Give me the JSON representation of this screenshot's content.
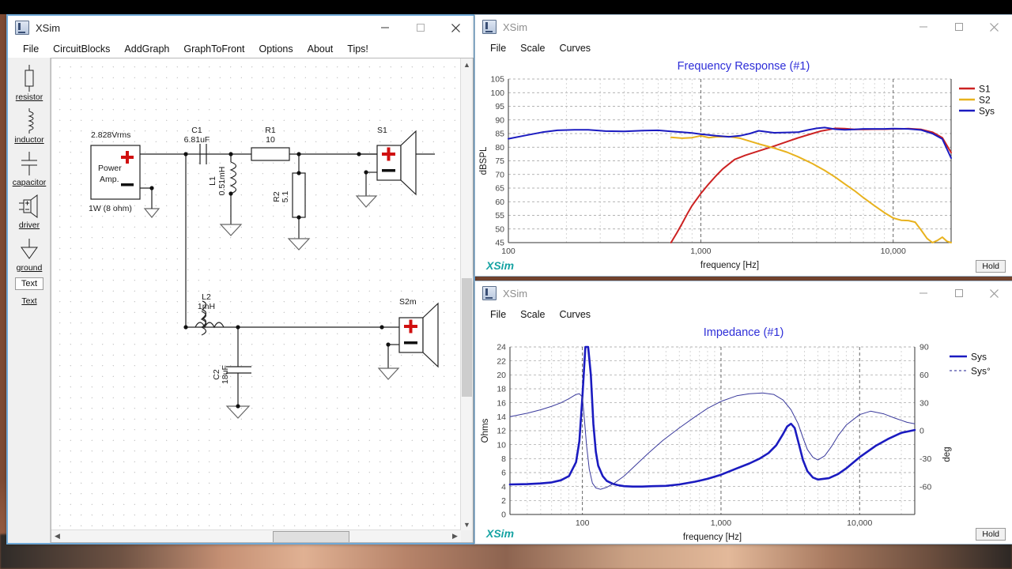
{
  "circuit_window": {
    "title": "XSim",
    "menus": [
      "File",
      "CircuitBlocks",
      "AddGraph",
      "GraphToFront",
      "Options",
      "About",
      "Tips!"
    ],
    "window_buttons": {
      "minimize": "minimize-icon",
      "maximize": "maximize-icon",
      "close": "close-icon"
    },
    "palette": [
      {
        "name": "resistor",
        "label": "resistor",
        "icon": "resistor-icon"
      },
      {
        "name": "inductor",
        "label": "inductor",
        "icon": "inductor-icon"
      },
      {
        "name": "capacitor",
        "label": "capacitor",
        "icon": "capacitor-icon"
      },
      {
        "name": "driver",
        "label": "driver",
        "icon": "driver-icon"
      },
      {
        "name": "ground",
        "label": "ground",
        "icon": "ground-icon"
      },
      {
        "name": "text-box",
        "label": "Text",
        "icon": "text-box-icon"
      },
      {
        "name": "text",
        "label": "Text",
        "icon": "text-icon"
      }
    ],
    "schematic": {
      "source_voltage": "2.828Vrms",
      "source_block_line1": "Power",
      "source_block_line2": "Amp.",
      "source_power": "1W (8 ohm)",
      "c1_ref": "C1",
      "c1_val": "6.81uF",
      "l1_ref": "L1",
      "l1_val": "0.51mH",
      "r1_ref": "R1",
      "r1_val": "10",
      "r2_ref": "R2",
      "r2_val": "5.1",
      "s1_ref": "S1",
      "l2_ref": "L2",
      "l2_val": "1mH",
      "c2_ref": "C2",
      "c2_val": "18uF",
      "s2_ref": "S2m",
      "plus": "+",
      "minus": "–"
    }
  },
  "fr_window": {
    "title": "XSim",
    "menus": [
      "File",
      "Scale",
      "Curves"
    ],
    "brand": "XSim",
    "hold_label": "Hold",
    "window_buttons": {
      "minimize": "minimize-icon",
      "maximize": "maximize-icon",
      "close": "close-icon"
    }
  },
  "imp_window": {
    "title": "XSim",
    "menus": [
      "File",
      "Scale",
      "Curves"
    ],
    "brand": "XSim",
    "hold_label": "Hold",
    "window_buttons": {
      "minimize": "minimize-icon",
      "maximize": "maximize-icon",
      "close": "close-icon"
    }
  },
  "chart_data": [
    {
      "type": "line",
      "title": "Frequency Response (#1)",
      "xlabel": "frequency [Hz]",
      "ylabel": "dBSPL",
      "xscale": "log",
      "xlim": [
        100,
        20000
      ],
      "ylim": [
        45,
        105
      ],
      "xticks": [
        100,
        1000,
        10000
      ],
      "xticklabels": [
        "100",
        "1,000",
        "10,000"
      ],
      "yticks": [
        45,
        50,
        55,
        60,
        65,
        70,
        75,
        80,
        85,
        90,
        95,
        100,
        105
      ],
      "grid": true,
      "legend_position": "right",
      "legend": [
        "S1",
        "S2",
        "Sys"
      ],
      "colors": {
        "S1": "#cc2222",
        "S2": "#e8b21e",
        "Sys": "#1b1bc0"
      },
      "series": [
        {
          "name": "S1",
          "color": "#cc2222",
          "x": [
            700,
            750,
            800,
            850,
            900,
            1000,
            1100,
            1200,
            1300,
            1500,
            1700,
            2000,
            2400,
            2800,
            3200,
            3800,
            4200,
            4600,
            5000,
            5600,
            6300,
            7000,
            8000,
            9000,
            10000,
            11000,
            12000,
            14000,
            16000,
            18000,
            20000
          ],
          "y": [
            45,
            48.5,
            52,
            55.5,
            58.5,
            63,
            66.5,
            69.5,
            72,
            75.5,
            77,
            78.6,
            80.4,
            82,
            83.4,
            85,
            85.9,
            86.4,
            86.9,
            86.8,
            86.5,
            86.5,
            86.6,
            86.6,
            86.7,
            86.7,
            86.8,
            86.5,
            85.5,
            83.5,
            78
          ]
        },
        {
          "name": "S2",
          "color": "#e8b21e",
          "x": [
            700,
            800,
            900,
            1000,
            1100,
            1200,
            1400,
            1600,
            1800,
            2000,
            2400,
            2800,
            3200,
            3800,
            4400,
            5000,
            5600,
            6300,
            7000,
            8000,
            9000,
            10000,
            11000,
            12000,
            13000,
            14000,
            15000,
            16000,
            17000,
            18000,
            19000,
            20000
          ],
          "y": [
            83.6,
            83.3,
            83.5,
            84.2,
            83.5,
            83.8,
            83.9,
            83.3,
            82.2,
            81.2,
            79.7,
            78.2,
            76.5,
            74.0,
            71.5,
            69.0,
            66.5,
            64.0,
            61.5,
            58.5,
            56.0,
            54.0,
            53.2,
            53.1,
            52.5,
            49.5,
            46.5,
            45.0,
            45.8,
            47.0,
            45.5,
            45
          ]
        },
        {
          "name": "Sys",
          "color": "#1b1bc0",
          "x": [
            100,
            120,
            150,
            180,
            220,
            260,
            320,
            400,
            500,
            600,
            700,
            800,
            900,
            1000,
            1200,
            1400,
            1600,
            1800,
            2000,
            2400,
            2800,
            3200,
            3600,
            4000,
            4400,
            5000,
            5600,
            6300,
            7000,
            8000,
            9000,
            10000,
            12000,
            14000,
            16000,
            18000,
            20000
          ],
          "y": [
            83.1,
            84.2,
            85.5,
            86.2,
            86.4,
            86.4,
            85.9,
            85.8,
            86.1,
            86.2,
            85.8,
            85.5,
            85.2,
            84.8,
            84.2,
            83.8,
            84.2,
            85.0,
            86.0,
            85.3,
            85.4,
            85.5,
            86.3,
            86.9,
            87.2,
            86.6,
            86.4,
            86.5,
            86.7,
            86.7,
            86.7,
            86.8,
            86.7,
            86.3,
            85.0,
            83.0,
            76.0
          ]
        }
      ]
    },
    {
      "type": "line",
      "title": "Impedance (#1)",
      "xlabel": "frequency [Hz]",
      "ylabel": "Ohms",
      "y2label": "deg",
      "xscale": "log",
      "xlim": [
        30,
        25000
      ],
      "ylim": [
        0,
        24
      ],
      "y2lim": [
        -90,
        90
      ],
      "xticks": [
        100,
        1000,
        10000
      ],
      "xticklabels": [
        "100",
        "1,000",
        "10,000"
      ],
      "yticks": [
        0,
        2,
        4,
        6,
        8,
        10,
        12,
        14,
        16,
        18,
        20,
        22,
        24
      ],
      "y2ticks": [
        -90,
        -60,
        -30,
        0,
        30,
        60,
        90
      ],
      "y2ticklabels": [
        "",
        "-60",
        "-30",
        "0",
        "30",
        "60",
        "90"
      ],
      "grid": true,
      "legend_position": "right",
      "legend": [
        "Sys",
        "Sys°"
      ],
      "colors": {
        "Sys": "#1b1bc0",
        "Sys_phase": "#4a4aa8"
      },
      "series": [
        {
          "name": "Sys",
          "style": "solid",
          "color": "#1b1bc0",
          "x": [
            30,
            40,
            50,
            60,
            70,
            80,
            90,
            95,
            100,
            105,
            110,
            115,
            120,
            125,
            130,
            140,
            150,
            165,
            180,
            200,
            230,
            270,
            320,
            400,
            500,
            650,
            800,
            1000,
            1300,
            1600,
            1900,
            2200,
            2500,
            2800,
            3000,
            3200,
            3400,
            3600,
            3900,
            4200,
            4600,
            5000,
            6000,
            7000,
            8000,
            10000,
            13000,
            16000,
            20000,
            25000
          ],
          "y": [
            4.3,
            4.35,
            4.45,
            4.6,
            4.9,
            5.5,
            7.5,
            10.5,
            17,
            24,
            24,
            20,
            13,
            9,
            7,
            5.5,
            4.8,
            4.4,
            4.2,
            4.05,
            4.0,
            4.0,
            4.05,
            4.1,
            4.3,
            4.7,
            5.1,
            5.7,
            6.6,
            7.3,
            8.0,
            8.8,
            9.9,
            11.5,
            12.6,
            13.0,
            12.4,
            10.5,
            7.8,
            6.2,
            5.3,
            5.0,
            5.2,
            5.8,
            6.6,
            8.2,
            9.8,
            10.8,
            11.7,
            12.1
          ]
        },
        {
          "name": "Sys°",
          "style": "thin",
          "color": "#3a3a9c",
          "x": [
            30,
            40,
            50,
            60,
            70,
            80,
            90,
            95,
            100,
            103,
            107,
            112,
            118,
            125,
            135,
            150,
            170,
            200,
            240,
            300,
            380,
            500,
            650,
            800,
            1000,
            1300,
            1600,
            2000,
            2400,
            2800,
            3200,
            3600,
            3900,
            4200,
            4600,
            5000,
            5600,
            6300,
            7000,
            8000,
            10000,
            12000,
            15000,
            18000,
            22000,
            25000
          ],
          "y": [
            14.0,
            14.5,
            15.0,
            15.5,
            16.0,
            16.6,
            17.2,
            17.3,
            16.8,
            14.0,
            10.0,
            6.5,
            4.5,
            3.8,
            3.6,
            3.9,
            4.5,
            5.5,
            7.0,
            8.8,
            10.6,
            12.4,
            14.0,
            15.2,
            16.2,
            17.0,
            17.3,
            17.4,
            17.2,
            16.4,
            15.0,
            13.0,
            11.0,
            9.3,
            8.2,
            7.8,
            8.4,
            9.8,
            11.3,
            12.8,
            14.3,
            14.8,
            14.4,
            13.8,
            13.2,
            13.0
          ]
        }
      ]
    }
  ]
}
